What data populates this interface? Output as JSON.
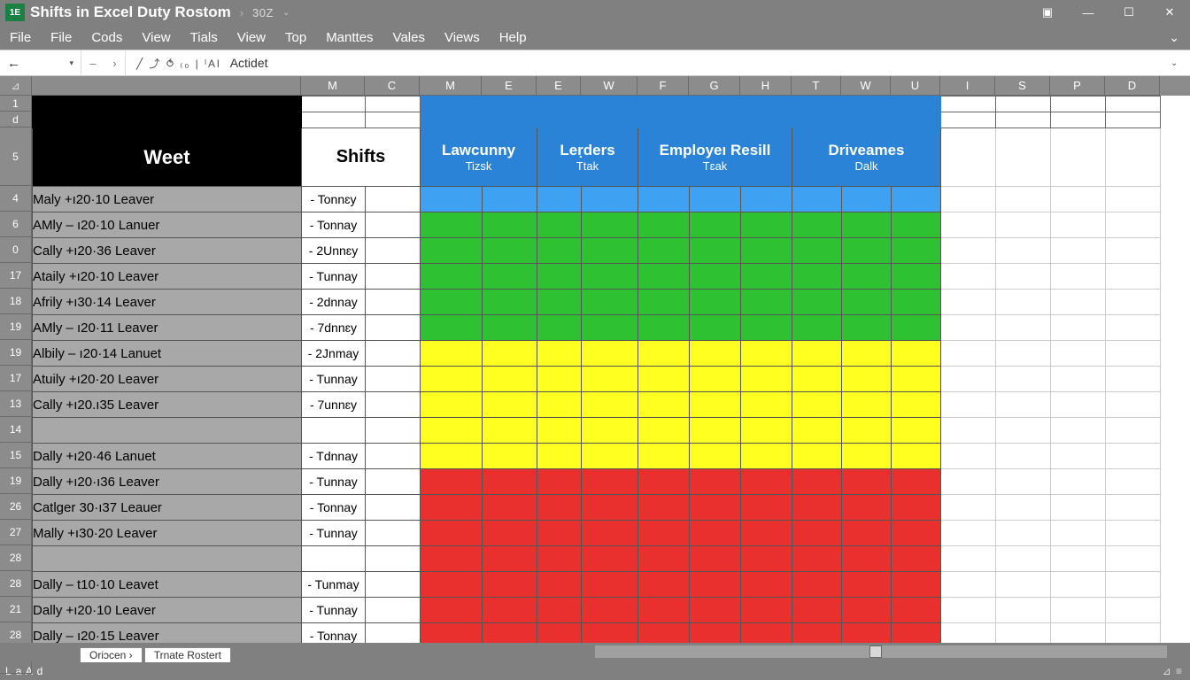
{
  "titlebar": {
    "app_badge": "1E",
    "title": "Shifts in Excel Duty Rostom",
    "separator": "›",
    "zoom": "30Z",
    "chev": "⌄"
  },
  "win": {
    "layout": "▣",
    "min": "—",
    "max": "☐",
    "close": "✕"
  },
  "menu": [
    "File",
    "File",
    "Cods",
    "View",
    "Tials",
    "View",
    "Top",
    "Manttes",
    "Vales",
    "Views",
    "Help"
  ],
  "toolbar": {
    "back": "←",
    "dd": "▾",
    "minus": "–",
    "fwd": "›",
    "fx_icons": "╱  ⤴  ⥀  ₍₀  |  ˡAl",
    "fx_text": "Actidet",
    "expand": "⌄"
  },
  "colheads_leading": "⊿",
  "colheads": [
    "M",
    "C",
    "M",
    "E",
    "E",
    "W",
    "F",
    "G",
    "H",
    "T",
    "W",
    "U",
    "I",
    "S",
    "P",
    "D"
  ],
  "rowheads": [
    "1",
    "d",
    "5",
    "4",
    "6",
    "0",
    "17",
    "18",
    "19",
    "19",
    "17",
    "13",
    "14",
    "15",
    "19",
    "26",
    "27",
    "28",
    "28",
    "21",
    "28",
    ""
  ],
  "header": {
    "weet": "Weet",
    "shifts": "Shifts",
    "groups": [
      {
        "h1": "Lawcunny",
        "h2": "Tizsk"
      },
      {
        "h1": "Leṛders",
        "h2": "Ttak"
      },
      {
        "h1": "Employeı Resill",
        "h2": "Tɛak"
      },
      {
        "h1": "Driveames",
        "h2": "Dalk"
      }
    ]
  },
  "rows": [
    {
      "name": "Maly  +ı20·10   Leaver",
      "shift": "- Tonnɛy",
      "color": "blue"
    },
    {
      "name": "AMly – ı20·10   Lanuer",
      "shift": "- Tonnay",
      "color": "green"
    },
    {
      "name": "Cally +ı20·36   Leaver",
      "shift": "- 2Unnɛy",
      "color": "green"
    },
    {
      "name": "Ataily  +ı20·10   Leaver",
      "shift": "- Tunnay",
      "color": "green"
    },
    {
      "name": "Afrily  +ı30·14   Leaver",
      "shift": "- 2dnnay",
      "color": "green"
    },
    {
      "name": "AMly – ı20·11   Leaver",
      "shift": "- 7dnnɛy",
      "color": "green"
    },
    {
      "name": "Albily – ı20·14   Lanuet",
      "shift": "- 2Jnmay",
      "color": "yellow"
    },
    {
      "name": "Atuily  +ı20·20   Leaver",
      "shift": "- Tunnay",
      "color": "yellow"
    },
    {
      "name": "Cally  +ı20.ı35   Leaver",
      "shift": "- 7unnɛy",
      "color": "yellow"
    },
    {
      "name": "",
      "shift": "",
      "color": "yellow"
    },
    {
      "name": "Dally +ı20·46   Lanuet",
      "shift": "- Tdnnay",
      "color": "yellow"
    },
    {
      "name": "Dally +ı20·ı36   Leaver",
      "shift": "- Tunnay",
      "color": "red"
    },
    {
      "name": "Catlger 30·ı37   Leauer",
      "shift": "- Tonnay",
      "color": "red"
    },
    {
      "name": "Mally +ı30·20   Leaver",
      "shift": "- Tunnay",
      "color": "red"
    },
    {
      "name": "",
      "shift": "",
      "color": "red"
    },
    {
      "name": "Dally – t10·10   Leavet",
      "shift": "- Tunmay",
      "color": "red"
    },
    {
      "name": "Dally +ı20·10   Leaver",
      "shift": "- Tunnay",
      "color": "red"
    },
    {
      "name": "Dally – ı20·15   Leaver",
      "shift": "- Tonnay",
      "color": "red"
    }
  ],
  "tabs": {
    "t1": "Oriɔcen ›",
    "t2": "Trnate Rostert"
  },
  "status": {
    "left": "L a A d",
    "right": "⊿  ≡"
  }
}
